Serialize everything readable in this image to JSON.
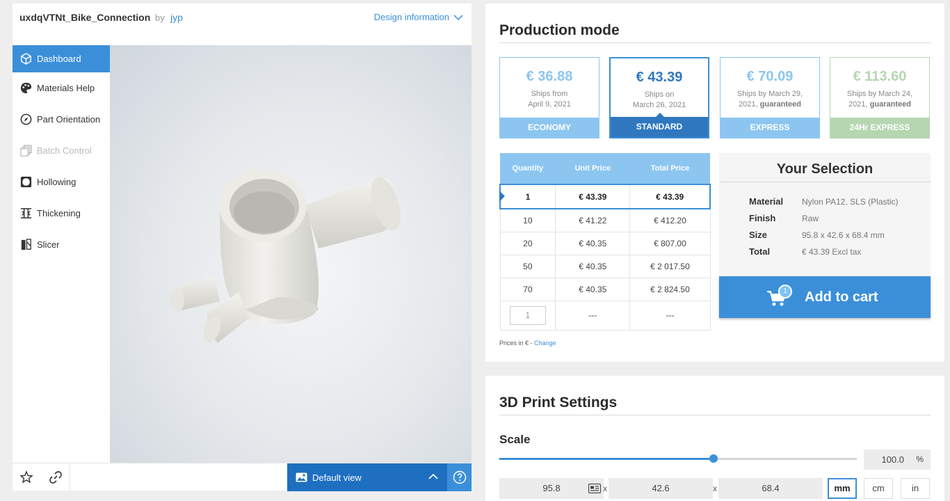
{
  "design": {
    "title": "uxdqVTNt_Bike_Connection",
    "by_label": "by",
    "author": "jyp",
    "info_link": "Design information"
  },
  "nav": {
    "items": [
      {
        "label": "Dashboard",
        "icon": "cube-icon",
        "state": "active"
      },
      {
        "label": "Materials Help",
        "icon": "palette-icon",
        "state": "normal"
      },
      {
        "label": "Part Orientation",
        "icon": "compass-icon",
        "state": "normal"
      },
      {
        "label": "Batch Control",
        "icon": "stack-icon",
        "state": "disabled"
      },
      {
        "label": "Hollowing",
        "icon": "hollow-square-icon",
        "state": "normal"
      },
      {
        "label": "Thickening",
        "icon": "thicken-icon",
        "state": "normal"
      },
      {
        "label": "Slicer",
        "icon": "slicer-icon",
        "state": "normal"
      }
    ]
  },
  "viewer": {
    "default_view_label": "Default view",
    "model_color": "#ecebe6"
  },
  "production": {
    "title": "Production mode",
    "options": [
      {
        "price": "€ 36.88",
        "line1": "Ships from",
        "line2": "April 9, 2021",
        "strong": "",
        "label": "ECONOMY",
        "style": "normal"
      },
      {
        "price": "€ 43.39",
        "line1": "Ships on",
        "line2": "March 26, 2021",
        "strong": "",
        "label": "STANDARD",
        "style": "selected"
      },
      {
        "price": "€ 70.09",
        "line1": "Ships by March 29,",
        "line2": "2021,",
        "strong": "guaranteed",
        "label": "EXPRESS",
        "style": "normal"
      },
      {
        "price": "€ 113.60",
        "line1": "Ships by March 24,",
        "line2": "2021,",
        "strong": "guaranteed",
        "label": "24Hr EXPRESS",
        "style": "green"
      }
    ],
    "table": {
      "headers": [
        "Quantity",
        "Unit Price",
        "Total Price"
      ],
      "rows": [
        {
          "qty": "1",
          "unit": "€ 43.39",
          "total": "€ 43.39",
          "selected": true
        },
        {
          "qty": "10",
          "unit": "€ 41.22",
          "total": "€ 412.20",
          "selected": false
        },
        {
          "qty": "20",
          "unit": "€ 40.35",
          "total": "€ 807.00",
          "selected": false
        },
        {
          "qty": "50",
          "unit": "€ 40.35",
          "total": "€ 2 017.50",
          "selected": false
        },
        {
          "qty": "70",
          "unit": "€ 40.35",
          "total": "€ 2 824.50",
          "selected": false
        }
      ],
      "custom_row": {
        "input_value": "1",
        "unit": "---",
        "total": "---"
      }
    },
    "prices_note": "Prices in € -",
    "change_link": "Change",
    "selection": {
      "title": "Your Selection",
      "material_label": "Material",
      "material_value": "Nylon PA12, SLS (Plastic)",
      "finish_label": "Finish",
      "finish_value": "Raw",
      "size_label": "Size",
      "size_value": "95.8 x 42.6 x 68.4 mm",
      "total_label": "Total",
      "total_value": "€ 43.39 Excl tax"
    },
    "add_to_cart": "Add to cart",
    "cart_count": "1"
  },
  "settings": {
    "title": "3D Print Settings",
    "scale_label": "Scale",
    "scale_fraction": 0.6,
    "scale_value": "100.0",
    "scale_unit": "%",
    "dims": [
      "95.8",
      "42.6",
      "68.4"
    ],
    "times": "x",
    "units": [
      "mm",
      "cm",
      "in"
    ],
    "selected_unit": "mm"
  },
  "colors": {
    "accent": "#3b8fd9",
    "standard": "#2f78c0",
    "economy": "#8cc6f0",
    "express24": "#b5d6b1"
  }
}
